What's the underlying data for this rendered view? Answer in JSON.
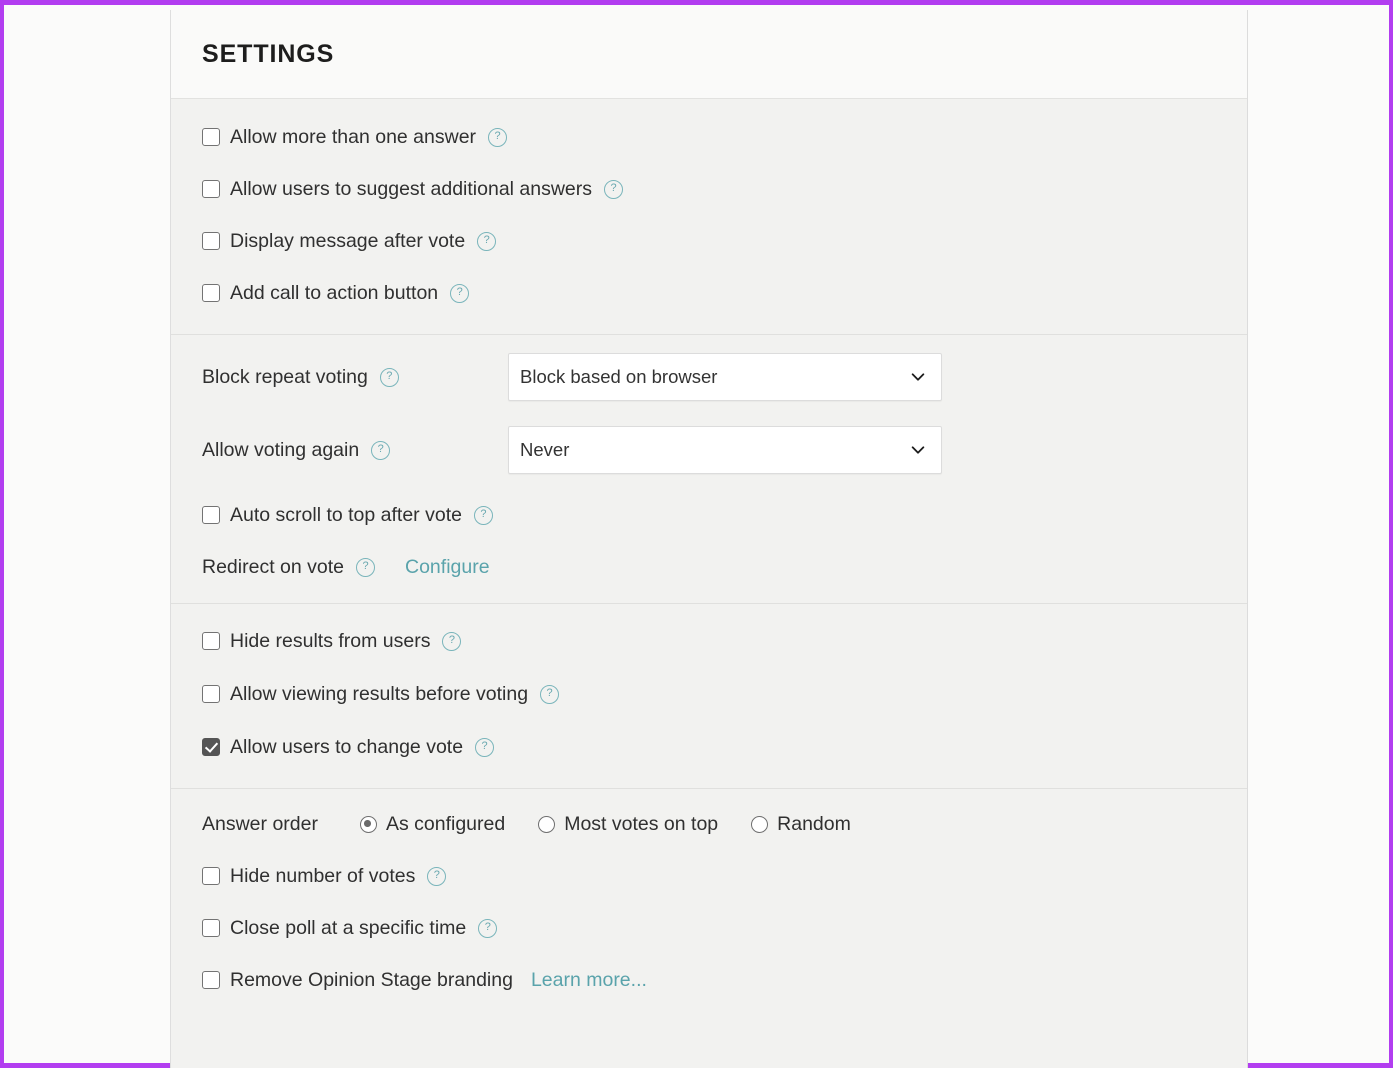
{
  "frame": {
    "border_color": "#b23df0"
  },
  "panel": {
    "title": "SETTINGS",
    "accent_teal": "#5aa3ab",
    "help_icon_glyph": "?"
  },
  "sections": {
    "answers": {
      "items": [
        {
          "label": "Allow more than one answer",
          "checked": false,
          "help": true
        },
        {
          "label": "Allow users to suggest additional answers",
          "checked": false,
          "help": true
        },
        {
          "label": "Display message after vote",
          "checked": false,
          "help": true
        },
        {
          "label": "Add call to action button",
          "checked": false,
          "help": true
        }
      ]
    },
    "voting": {
      "block_repeat_voting": {
        "label": "Block repeat voting",
        "value": "Block based on browser"
      },
      "allow_voting_again": {
        "label": "Allow voting again",
        "value": "Never"
      },
      "auto_scroll": {
        "label": "Auto scroll to top after vote",
        "checked": false
      },
      "redirect": {
        "label": "Redirect on vote",
        "link": "Configure"
      }
    },
    "results": {
      "items": [
        {
          "label": "Hide results from users",
          "checked": false
        },
        {
          "label": "Allow viewing results before voting",
          "checked": false
        },
        {
          "label": "Allow users to change vote",
          "checked": true
        }
      ]
    },
    "display": {
      "answer_order": {
        "label": "Answer order",
        "options": [
          {
            "label": "As configured",
            "selected": true
          },
          {
            "label": "Most votes on top",
            "selected": false
          },
          {
            "label": "Random",
            "selected": false
          }
        ]
      },
      "items": [
        {
          "label": "Hide number of votes",
          "checked": false
        },
        {
          "label": "Close poll at a specific time",
          "checked": false
        }
      ],
      "branding": {
        "label": "Remove Opinion Stage branding",
        "checked": false,
        "link": "Learn more..."
      }
    }
  }
}
